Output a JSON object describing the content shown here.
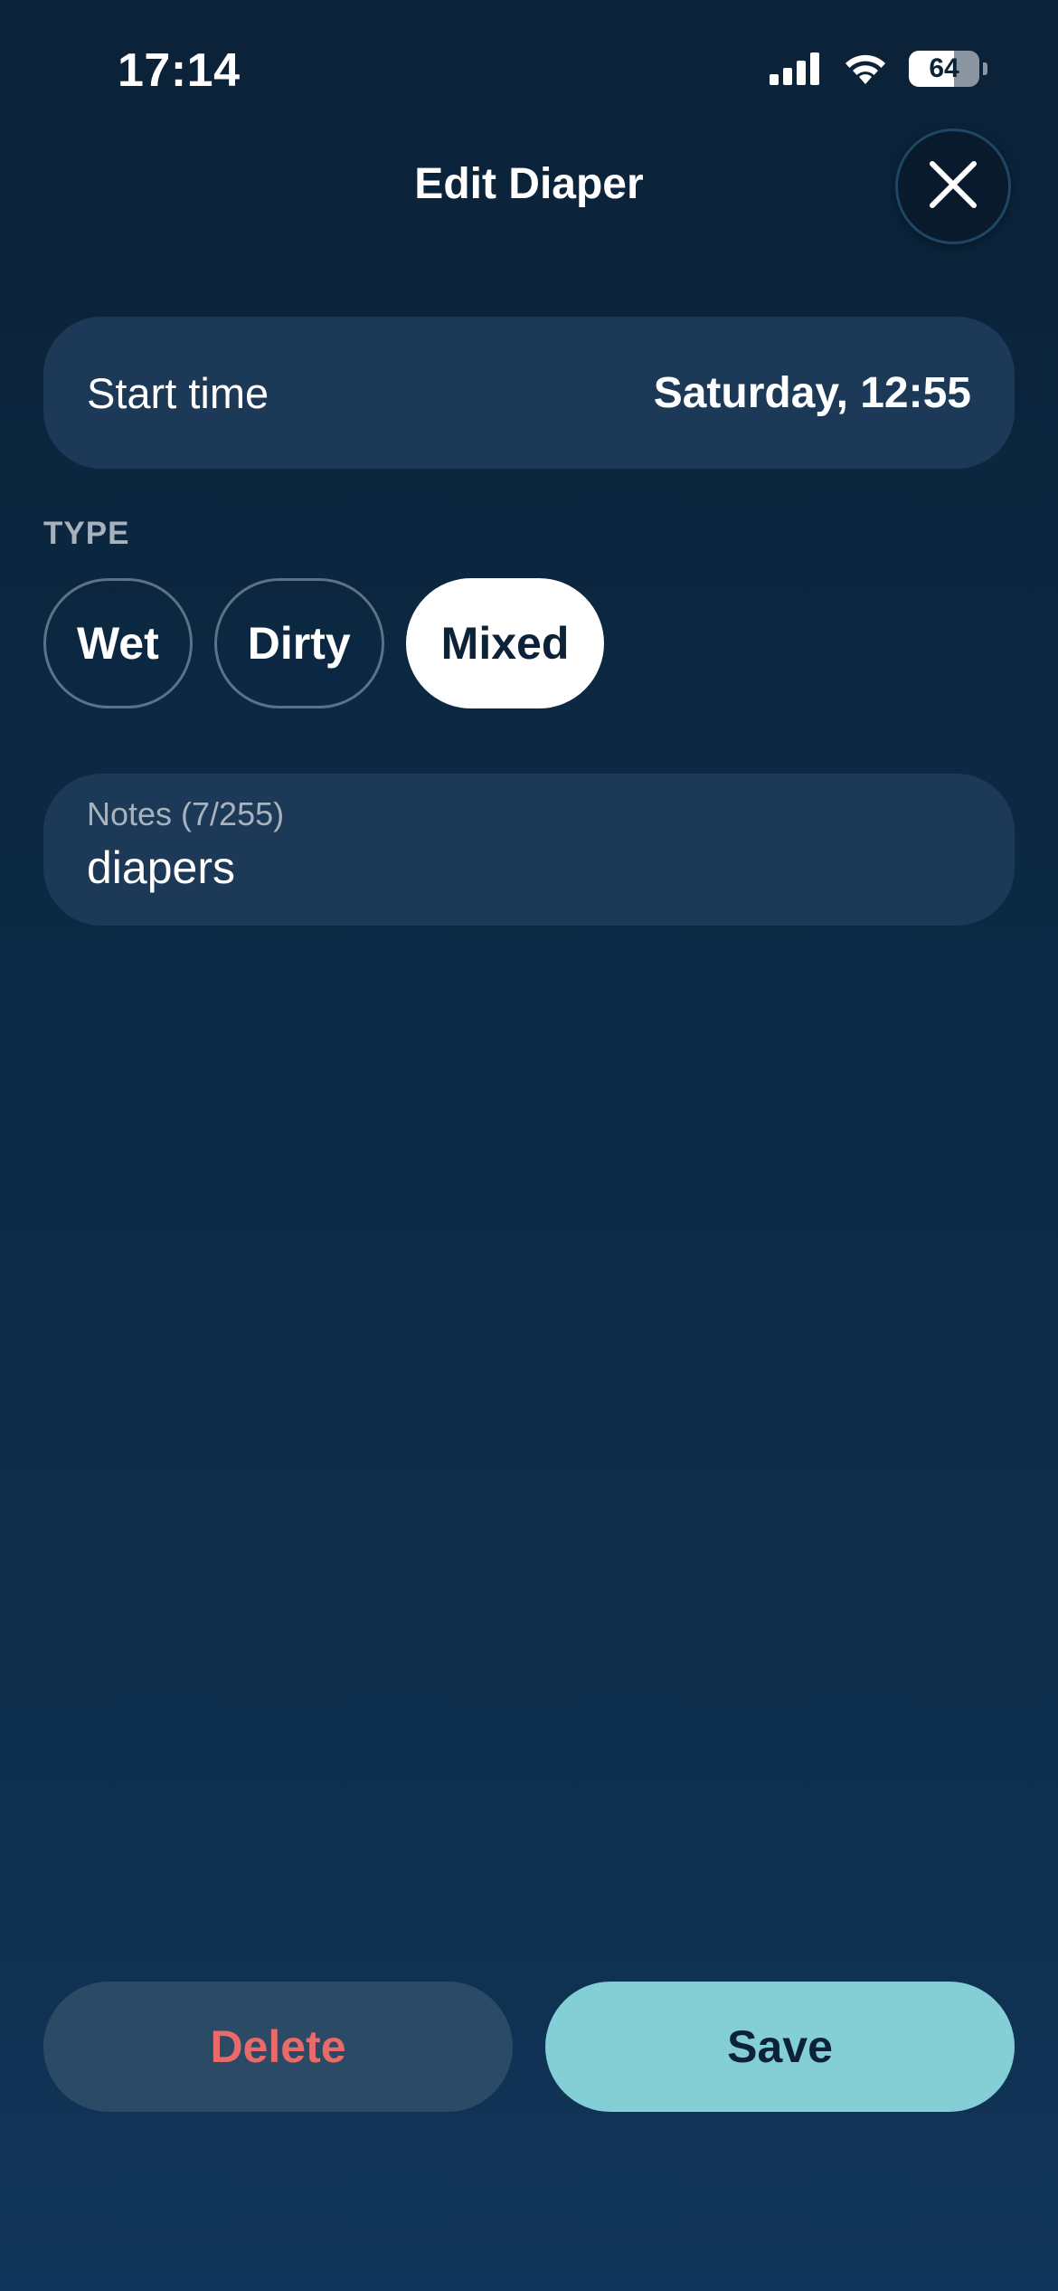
{
  "status_bar": {
    "time": "17:14",
    "battery_level": "64",
    "battery_fraction": 0.64,
    "icons": [
      "signal-icon",
      "wifi-icon",
      "battery-icon"
    ]
  },
  "header": {
    "title": "Edit Diaper",
    "close_icon": "close-icon"
  },
  "start_time": {
    "label": "Start time",
    "value": "Saturday, 12:55"
  },
  "type": {
    "label": "TYPE",
    "options": [
      {
        "label": "Wet",
        "selected": false
      },
      {
        "label": "Dirty",
        "selected": false
      },
      {
        "label": "Mixed",
        "selected": true
      }
    ]
  },
  "notes": {
    "label": "Notes",
    "count": "(7/255)",
    "value": "diapers"
  },
  "actions": {
    "delete_label": "Delete",
    "save_label": "Save"
  },
  "colors": {
    "background": "#0c2a46",
    "card": "#1c3a58",
    "accent": "#84ced6",
    "danger": "#ea6a6a"
  }
}
